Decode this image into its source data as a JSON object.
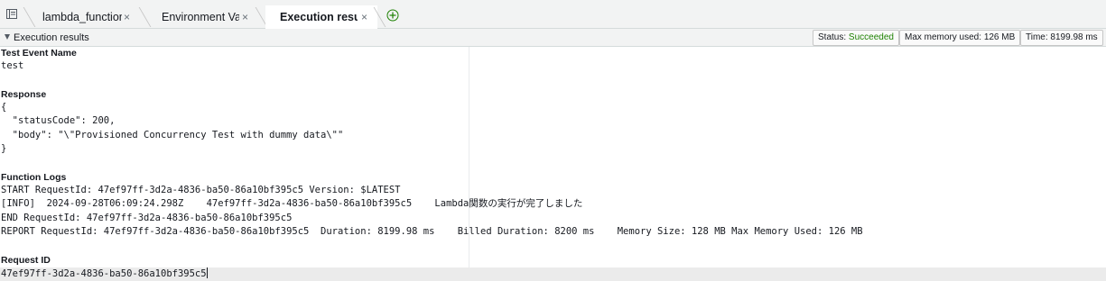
{
  "tabs": [
    {
      "label": "lambda_function",
      "close": "×"
    },
    {
      "label": "Environment Vari",
      "close": "×"
    },
    {
      "label": "Execution results",
      "close": "×"
    }
  ],
  "panel": {
    "title": "Execution results",
    "status": {
      "label": "Status:",
      "value": "Succeeded"
    },
    "memory": {
      "label": "Max memory used:",
      "value": "126 MB"
    },
    "time": {
      "label": "Time:",
      "value": "8199.98 ms"
    }
  },
  "results": {
    "test_event_heading": "Test Event Name",
    "test_event_value": "test",
    "response_heading": "Response",
    "response_lines": [
      "{",
      "  \"statusCode\": 200,",
      "  \"body\": \"\\\"Provisioned Concurrency Test with dummy data\\\"\"",
      "}"
    ],
    "logs_heading": "Function Logs",
    "log_lines": [
      "START RequestId: 47ef97ff-3d2a-4836-ba50-86a10bf395c5 Version: $LATEST",
      "[INFO]  2024-09-28T06:09:24.298Z    47ef97ff-3d2a-4836-ba50-86a10bf395c5    Lambda関数の実行が完了しました",
      "END RequestId: 47ef97ff-3d2a-4836-ba50-86a10bf395c5",
      "REPORT RequestId: 47ef97ff-3d2a-4836-ba50-86a10bf395c5  Duration: 8199.98 ms    Billed Duration: 8200 ms    Memory Size: 128 MB Max Memory Used: 126 MB"
    ],
    "request_id_heading": "Request ID",
    "request_id_value": "47ef97ff-3d2a-4836-ba50-86a10bf395c5"
  },
  "colors": {
    "success": "#1d8102",
    "add_tab": "#1d8102"
  },
  "icons": {
    "menu": "file-menu-icon",
    "add": "add-tab-icon",
    "caret": "caret-down-icon"
  }
}
